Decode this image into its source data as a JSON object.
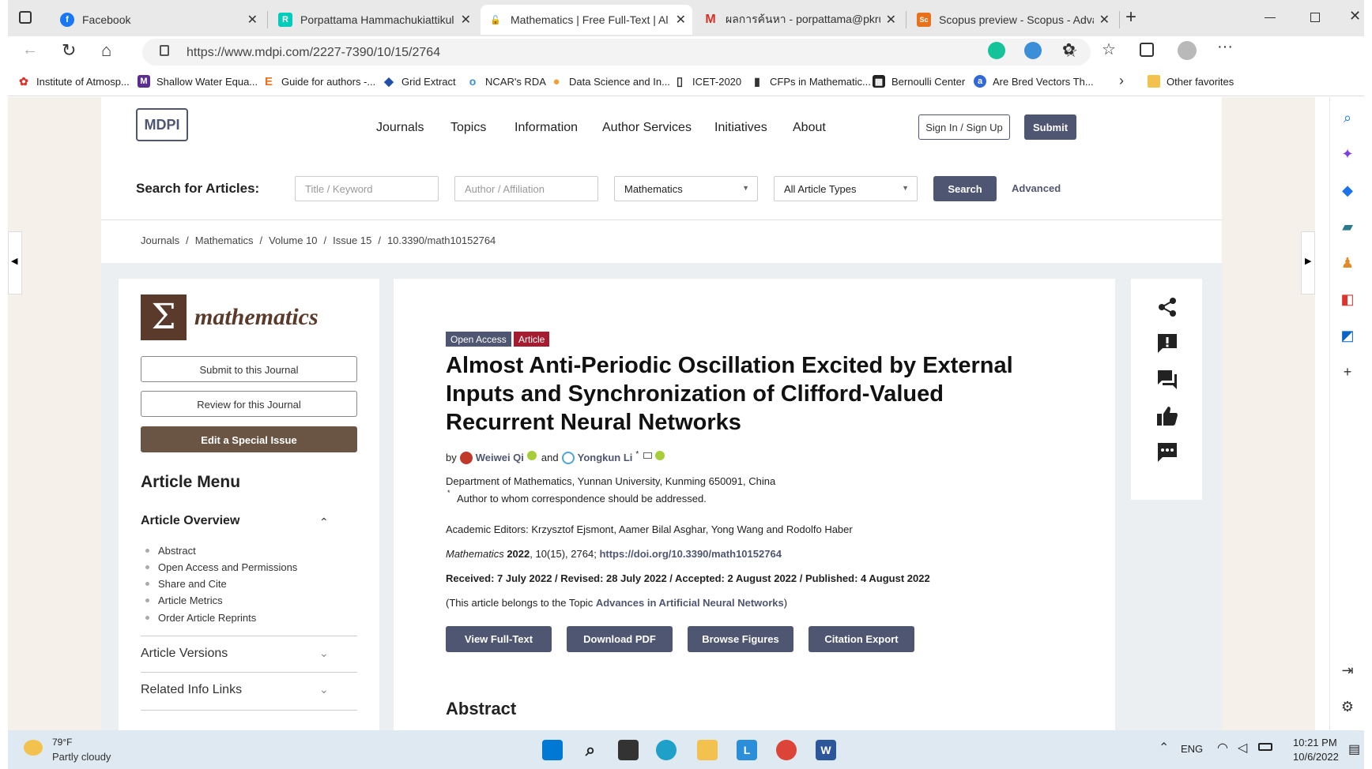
{
  "browser": {
    "tabs": [
      {
        "label": "Facebook",
        "favicon": "facebook-icon",
        "color": "#1877f2",
        "glyph": "f"
      },
      {
        "label": "Porpattama Hammachukiattikul |",
        "favicon": "researchgate-icon",
        "color": "#00ccbb",
        "glyph": "R"
      },
      {
        "label": "Mathematics | Free Full-Text | Alr",
        "favicon": "lock-open-icon",
        "color": "#555555",
        "glyph": "🔓"
      },
      {
        "label": "ผลการค้นหา - porpattama@pkru.a",
        "favicon": "gmail-icon",
        "color": "#d93025",
        "glyph": "M"
      },
      {
        "label": "Scopus preview - Scopus - Advar",
        "favicon": "scopus-icon",
        "color": "#e9711c",
        "glyph": "Sc"
      }
    ],
    "new_tab": "+",
    "url": "https://www.mdpi.com/2227-7390/10/15/2764",
    "bookmarks": [
      {
        "label": "Institute of Atmosp...",
        "icon": "huawei-icon",
        "color": "#e0322c",
        "glyph": "✿"
      },
      {
        "label": "Shallow Water Equa...",
        "icon": "m-icon",
        "color": "#5b2d8e",
        "glyph": "M"
      },
      {
        "label": "Guide for authors -...",
        "icon": "elsevier-icon",
        "color": "#e9711c",
        "glyph": "E"
      },
      {
        "label": "Grid Extract",
        "icon": "shield-icon",
        "color": "#1f4fa8",
        "glyph": "◆"
      },
      {
        "label": "NCAR's RDA",
        "icon": "rda-icon",
        "color": "#3b8fd1",
        "glyph": "o"
      },
      {
        "label": "Data Science and In...",
        "icon": "datascience-icon",
        "color": "#f0a030",
        "glyph": "●"
      },
      {
        "label": "ICET-2020",
        "icon": "page-icon",
        "color": "#ffffff",
        "glyph": "▯"
      },
      {
        "label": "CFPs in Mathematic...",
        "icon": "cfp-icon",
        "color": "#333333",
        "glyph": "▮"
      },
      {
        "label": "Bernoulli Center",
        "icon": "bernoulli-icon",
        "color": "#222222",
        "glyph": "▦"
      },
      {
        "label": "Are Bred Vectors Th...",
        "icon": "a-icon",
        "color": "#3068d8",
        "glyph": "a"
      }
    ],
    "other_favorites": "Other favorites"
  },
  "site": {
    "logo": "MDPI",
    "nav": [
      "Journals",
      "Topics",
      "Information",
      "Author Services",
      "Initiatives",
      "About"
    ],
    "sign_in": "Sign In / Sign Up",
    "submit": "Submit",
    "search_label": "Search for Articles:",
    "title_placeholder": "Title / Keyword",
    "author_placeholder": "Author / Affiliation",
    "journal_select": "Mathematics",
    "type_select": "All Article Types",
    "search_button": "Search",
    "advanced": "Advanced",
    "breadcrumb": [
      "Journals",
      "/",
      "Mathematics",
      "/",
      "Volume 10",
      "/",
      "Issue 15",
      "/",
      "10.3390/math10152764"
    ]
  },
  "sidebar": {
    "journal_symbol": "Σ",
    "journal_name": "mathematics",
    "submit_journal": "Submit to this Journal",
    "review_journal": "Review for this Journal",
    "edit_special": "Edit a Special Issue",
    "menu_title": "Article Menu",
    "overview_title": "Article Overview",
    "overview_items": [
      "Abstract",
      "Open Access and Permissions",
      "Share and Cite",
      "Article Metrics",
      "Order Article Reprints"
    ],
    "versions": "Article Versions",
    "related": "Related Info Links"
  },
  "article": {
    "badge_open": "Open Access",
    "badge_article": "Article",
    "title": "Almost Anti-Periodic Oscillation Excited by External Inputs and Synchronization of Clifford-Valued Recurrent Neural Networks",
    "by": "by",
    "author1": "Weiwei Qi",
    "and": "and",
    "author2": "Yongkun Li",
    "author2_mark": "*",
    "affiliation": "Department of Mathematics, Yunnan University, Kunming 650091, China",
    "corr_mark": "*",
    "correspondence": "Author to whom correspondence should be addressed.",
    "editors": "Academic Editors: Krzysztof Ejsmont, Aamer Bilal Asghar, Yong Wang and Rodolfo Haber",
    "citation_journal": "Mathematics",
    "citation_year": "2022",
    "citation_rest": ", 10(15), 2764;",
    "doi": "https://doi.org/10.3390/math10152764",
    "dates": "Received: 7 July 2022 / Revised: 28 July 2022 / Accepted: 2 August 2022 / Published: 4 August 2022",
    "topic_prefix": "(This article belongs to the Topic",
    "topic_link": "Advances in Artificial Neural Networks",
    "topic_suffix": ")",
    "buttons": [
      "View Full-Text",
      "Download PDF",
      "Browse Figures",
      "Citation Export"
    ],
    "abstract_heading": "Abstract"
  },
  "taskbar": {
    "temp": "79°F",
    "weather": "Partly cloudy",
    "lang": "ENG",
    "time": "10:21 PM",
    "date": "10/6/2022"
  }
}
